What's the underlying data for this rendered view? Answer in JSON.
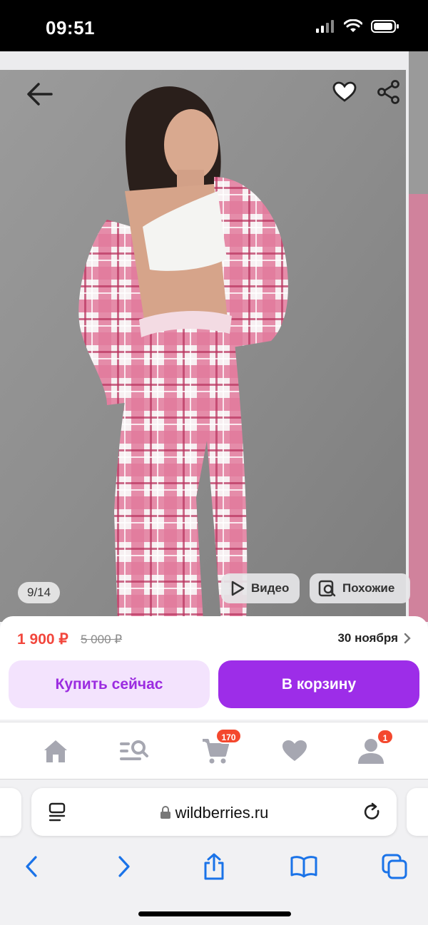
{
  "status_bar": {
    "time": "09:51"
  },
  "gallery": {
    "counter": "9/14",
    "video_label": "Видео",
    "similar_label": "Похожие"
  },
  "product": {
    "price_current": "1 900 ₽",
    "price_old": "5 000 ₽",
    "delivery_date": "30 ноября",
    "buy_now_label": "Купить сейчас",
    "add_to_cart_label": "В корзину"
  },
  "tabbar": {
    "items": [
      {
        "icon": "home-icon"
      },
      {
        "icon": "catalog-search-icon"
      },
      {
        "icon": "cart-icon",
        "badge": "170"
      },
      {
        "icon": "heart-icon"
      },
      {
        "icon": "profile-icon",
        "badge": "1"
      }
    ]
  },
  "browser": {
    "url": "wildberries.ru"
  },
  "colors": {
    "price": "#f2463c",
    "accent": "#9d2de8",
    "accent_light": "#f3e3fd",
    "badge": "#f4482e"
  }
}
